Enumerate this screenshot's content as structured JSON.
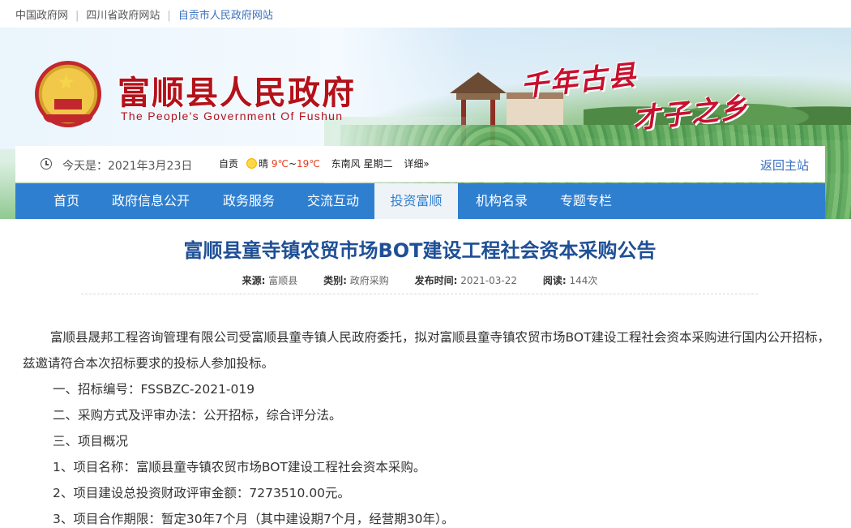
{
  "top_links": [
    "中国政府网",
    "四川省政府网站",
    "自贡市人民政府网站"
  ],
  "header": {
    "title": "富顺县人民政府",
    "subtitle": "The People's Government Of Fushun",
    "slogan_1": "千年古县",
    "slogan_2": "才子之乡"
  },
  "info_bar": {
    "today": "今天是：2021年3月23日",
    "city": "自贡",
    "weather": "晴",
    "temp_low": "9℃",
    "temp_sep": "~",
    "temp_high": "19℃",
    "wind": "东南风",
    "weekday": "星期二",
    "details": "详细»",
    "back_home": "返回主站"
  },
  "nav": {
    "items": [
      "首页",
      "政府信息公开",
      "政务服务",
      "交流互动",
      "投资富顺",
      "机构名录",
      "专题专栏"
    ],
    "active_index": 4
  },
  "article": {
    "title": "富顺县童寺镇农贸市场BOT建设工程社会资本采购公告",
    "meta": {
      "source_label": "来源:",
      "source": "富顺县",
      "category_label": "类别:",
      "category": "政府采购",
      "date_label": "发布时间:",
      "date": "2021-03-22",
      "views_label": "阅读:",
      "views": "144次"
    },
    "paragraphs": [
      "富顺县晟邦工程咨询管理有限公司受富顺县童寺镇人民政府委托，拟对富顺县童寺镇农贸市场BOT建设工程社会资本采购进行国内公开招标，兹邀请符合本次招标要求的投标人参加投标。",
      "一、招标编号：FSSBZC-2021-019",
      "二、采购方式及评审办法：公开招标，综合评分法。",
      "三、项目概况",
      "1、项目名称：富顺县童寺镇农贸市场BOT建设工程社会资本采购。",
      "2、项目建设总投资财政评审金额：7273510.00元。",
      "3、项目合作期限：暂定30年7个月（其中建设期7个月，经营期30年）。"
    ]
  }
}
